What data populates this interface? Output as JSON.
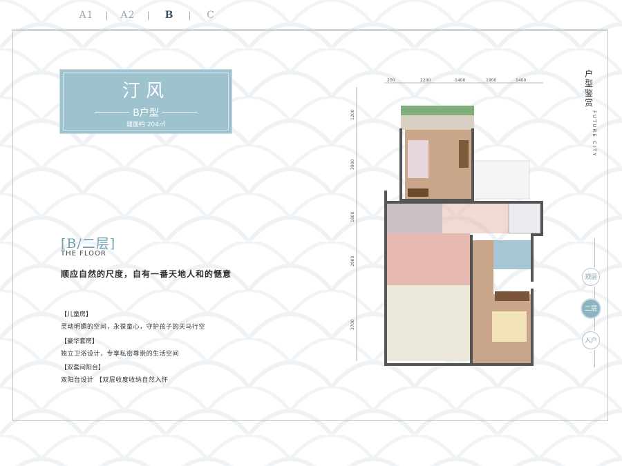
{
  "tabs": [
    {
      "label": "A1",
      "active": false
    },
    {
      "label": "A2",
      "active": false
    },
    {
      "label": "B",
      "active": true
    },
    {
      "label": "C",
      "active": false
    }
  ],
  "tab_separator": "|",
  "title_card": {
    "name": "汀风",
    "type": "B户型",
    "area": "建面约 204㎡"
  },
  "section": {
    "title": "[B/二层]",
    "subtitle": "THE FLOOR",
    "slogan": "顺应自然的尺度，自有一番天地人和的惬意"
  },
  "features": [
    {
      "heading": "【儿童房】",
      "desc": "灵动明媚的空间，永葆童心，守护孩子的天马行空"
    },
    {
      "heading": "【豪华套房】",
      "desc": "独立卫浴设计，专享私密尊崇的生活空间"
    },
    {
      "heading": "【双套间阳台】",
      "desc": "双阳台设计  【双层收度收纳自然入怀"
    }
  ],
  "side": {
    "title": "户型鉴赏",
    "subtitle": "FUTURE CITY",
    "floors": [
      {
        "label": "顶层",
        "active": false
      },
      {
        "label": "二层",
        "active": true
      },
      {
        "label": "入户",
        "active": false
      }
    ]
  },
  "plan": {
    "top_dims": [
      "200",
      "2200",
      "1400",
      "1900",
      "1400"
    ],
    "left_dims": [
      "1200",
      "3900",
      "1800",
      "2900",
      "3700"
    ]
  },
  "colors": {
    "accent": "#9fc2cf",
    "accent_dark": "#6a9fb3",
    "floor_wood": "#c9a68a",
    "floor_tile": "#e6b9b0",
    "wall": "#555555"
  }
}
